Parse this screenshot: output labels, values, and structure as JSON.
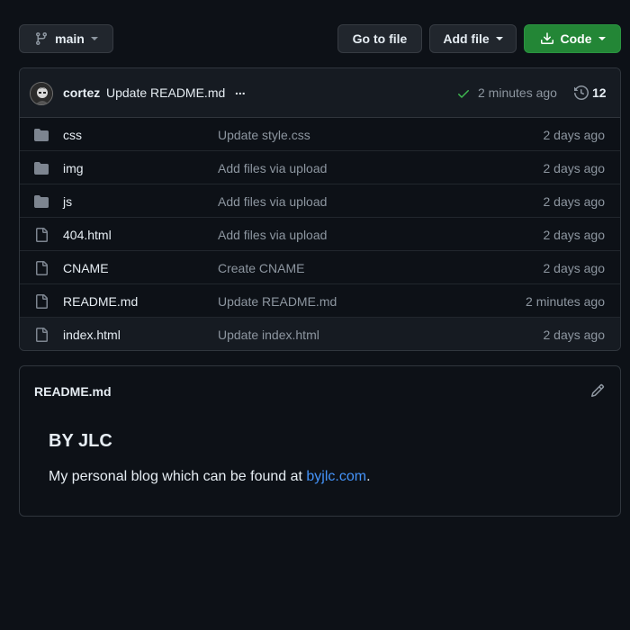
{
  "toolbar": {
    "branch_label": "main",
    "goto_file_label": "Go to file",
    "add_file_label": "Add file",
    "code_label": "Code"
  },
  "latest_commit": {
    "author": "cortez",
    "message": "Update README.md",
    "more": "...",
    "time": "2 minutes ago",
    "commit_count": "12",
    "status_color": "#3fb950"
  },
  "files": [
    {
      "type": "folder",
      "name": "css",
      "commit": "Update style.css",
      "age": "2 days ago"
    },
    {
      "type": "folder",
      "name": "img",
      "commit": "Add files via upload",
      "age": "2 days ago"
    },
    {
      "type": "folder",
      "name": "js",
      "commit": "Add files via upload",
      "age": "2 days ago"
    },
    {
      "type": "file",
      "name": "404.html",
      "commit": "Add files via upload",
      "age": "2 days ago"
    },
    {
      "type": "file",
      "name": "CNAME",
      "commit": "Create CNAME",
      "age": "2 days ago"
    },
    {
      "type": "file",
      "name": "README.md",
      "commit": "Update README.md",
      "age": "2 minutes ago"
    },
    {
      "type": "file",
      "name": "index.html",
      "commit": "Update index.html",
      "age": "2 days ago"
    }
  ],
  "readme": {
    "filename": "README.md",
    "title": "BY JLC",
    "text_before": "My personal blog which can be found at ",
    "link_text": "byjlc.com",
    "text_after": "."
  },
  "colors": {
    "background": "#0d1117",
    "code_button": "#238636",
    "link": "#4493f8",
    "muted_text": "#8d96a0",
    "folder_icon": "#7d8590"
  }
}
